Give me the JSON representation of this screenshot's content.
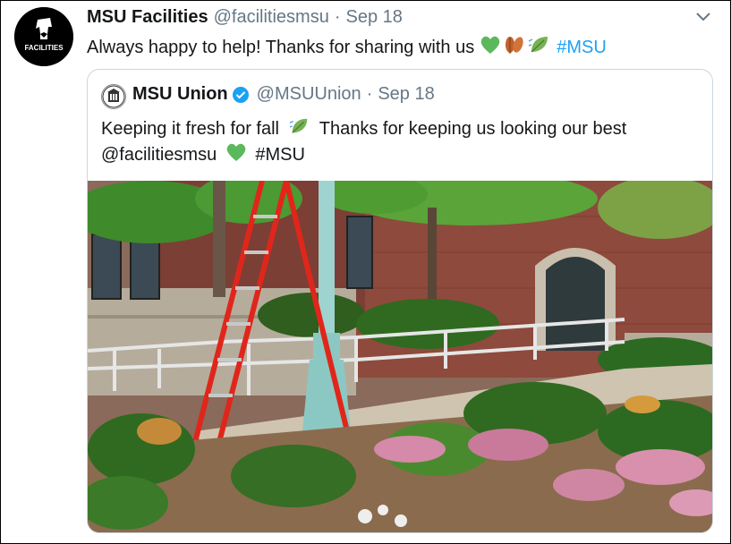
{
  "tweet": {
    "author_name": "MSU Facilities",
    "author_handle": "@facilitiesmsu",
    "separator": "·",
    "date": "Sep 18",
    "avatar_text": "FACILITIES",
    "text": "Always happy to help! Thanks for sharing with us",
    "hashtag": "#MSU",
    "emojis": [
      "green-heart",
      "fallen-leaves",
      "leaf-fluttering-in-wind"
    ]
  },
  "quoted_tweet": {
    "author_name": "MSU Union",
    "author_handle": "@MSUUnion",
    "separator": "·",
    "date": "Sep 18",
    "verified": true,
    "text_part1": "Keeping it fresh for fall",
    "text_part2": "Thanks for keeping us looking our best",
    "mention": "@facilitiesmsu",
    "hashtag": "#MSU",
    "photo_description_icon": "photo-image"
  },
  "colors": {
    "link": "#1da1f2",
    "secondary_text": "#657786",
    "border": "#ccd6dd",
    "verified": "#1da1f2",
    "green_heart": "#5cb85c"
  }
}
